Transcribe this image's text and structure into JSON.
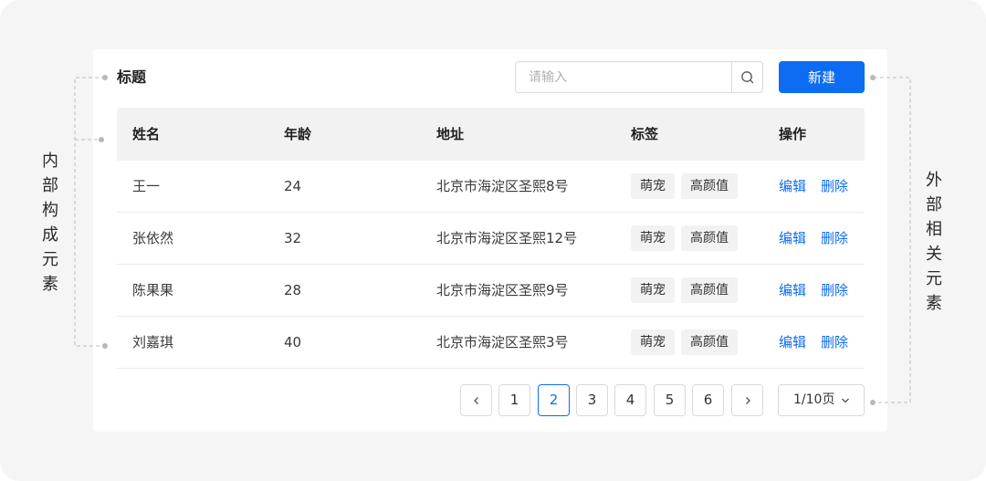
{
  "header": {
    "title": "标题",
    "search_placeholder": "请输入",
    "new_button": "新建"
  },
  "table": {
    "columns": [
      "姓名",
      "年龄",
      "地址",
      "标签",
      "操作"
    ],
    "rows": [
      {
        "name": "王一",
        "age": "24",
        "address": "北京市海淀区圣熙8号",
        "tags": [
          "萌宠",
          "高颜值"
        ],
        "actions": [
          "编辑",
          "删除"
        ]
      },
      {
        "name": "张依然",
        "age": "32",
        "address": "北京市海淀区圣熙12号",
        "tags": [
          "萌宠",
          "高颜值"
        ],
        "actions": [
          "编辑",
          "删除"
        ]
      },
      {
        "name": "陈果果",
        "age": "28",
        "address": "北京市海淀区圣熙9号",
        "tags": [
          "萌宠",
          "高颜值"
        ],
        "actions": [
          "编辑",
          "删除"
        ]
      },
      {
        "name": "刘嘉琪",
        "age": "40",
        "address": "北京市海淀区圣熙3号",
        "tags": [
          "萌宠",
          "高颜值"
        ],
        "actions": [
          "编辑",
          "删除"
        ]
      }
    ]
  },
  "pagination": {
    "pages": [
      "1",
      "2",
      "3",
      "4",
      "5",
      "6"
    ],
    "current": "2",
    "page_size": "1/10页"
  },
  "annotations": {
    "left": "内部构成元素",
    "right": "外部相关元素"
  },
  "colors": {
    "primary": "#0d6df2",
    "header_bg": "#f2f2f3",
    "tag_bg": "#f2f2f3",
    "connector": "#b8b8b8"
  },
  "icons": {
    "search": "search-icon",
    "prev": "chevron-left-icon",
    "next": "chevron-right-icon",
    "dropdown": "chevron-down-icon"
  }
}
